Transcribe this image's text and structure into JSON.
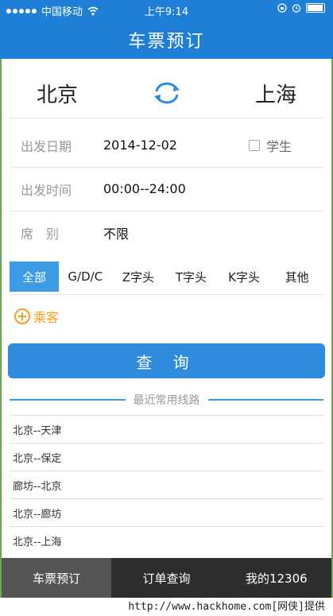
{
  "status_bar": {
    "carrier": "中国移动",
    "time": "上午9:14"
  },
  "nav": {
    "title": "车票预订"
  },
  "route": {
    "from": "北京",
    "to": "上海",
    "swap_icon": "swap-arrows-icon"
  },
  "form": {
    "date_label": "出发日期",
    "date_value": "2014-12-02",
    "student_label": "学生",
    "student_checked": false,
    "time_label": "出发时间",
    "time_value": "00:00--24:00",
    "seat_label": "席　别",
    "seat_value": "不限"
  },
  "train_tabs": [
    {
      "label": "全部",
      "active": true
    },
    {
      "label": "G/D/C",
      "active": false
    },
    {
      "label": "Z字头",
      "active": false
    },
    {
      "label": "T字头",
      "active": false
    },
    {
      "label": "K字头",
      "active": false
    },
    {
      "label": "其他",
      "active": false
    }
  ],
  "passenger": {
    "label": "乘客",
    "icon": "add-circle-icon"
  },
  "query_button": "查 询",
  "recent": {
    "title": "最近常用线路",
    "items": [
      "北京--天津",
      "北京--保定",
      "廊坊--北京",
      "北京--廊坊",
      "北京--上海"
    ]
  },
  "tab_bar": [
    {
      "label": "车票预订",
      "active": true
    },
    {
      "label": "订单查询",
      "active": false
    },
    {
      "label": "我的12306",
      "active": false
    }
  ],
  "watermark": "http://www.hackhome.com[网侠]提供",
  "colors": {
    "primary": "#1f7fd6",
    "accent": "#f5a020",
    "tabbar": "#2e2e2e"
  }
}
